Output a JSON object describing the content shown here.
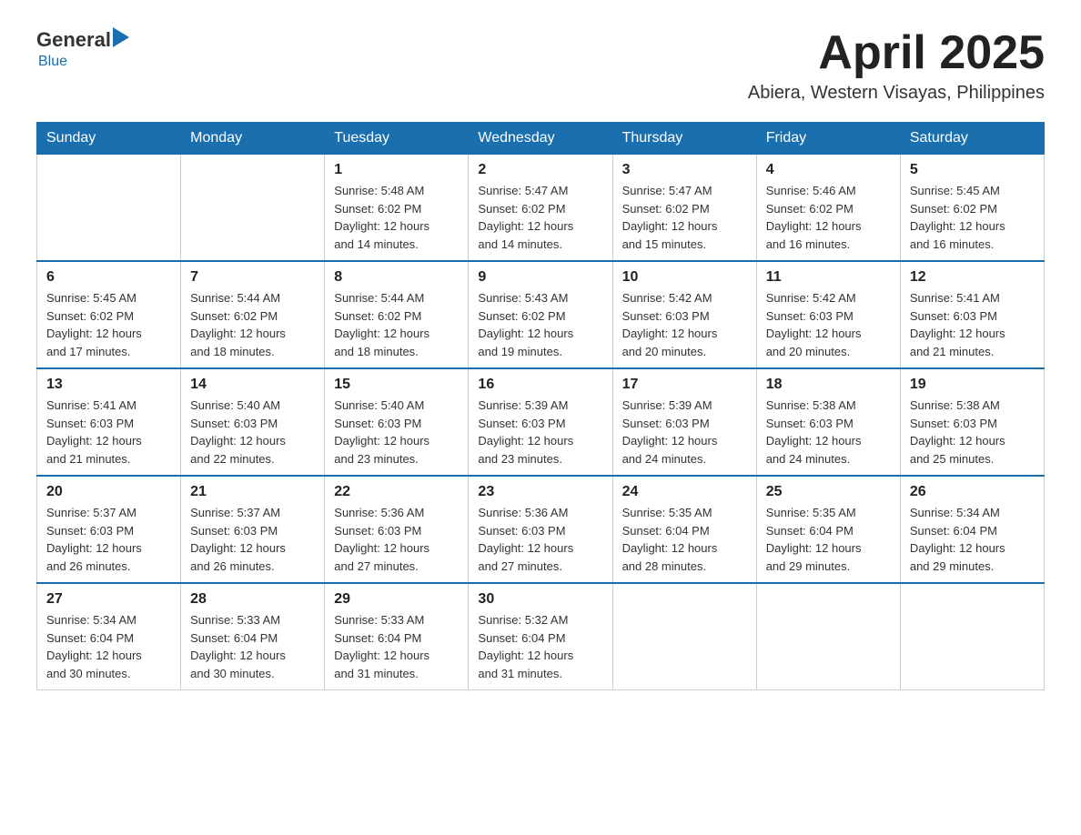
{
  "header": {
    "logo_text": "General",
    "logo_blue": "Blue",
    "month": "April 2025",
    "location": "Abiera, Western Visayas, Philippines"
  },
  "weekdays": [
    "Sunday",
    "Monday",
    "Tuesday",
    "Wednesday",
    "Thursday",
    "Friday",
    "Saturday"
  ],
  "weeks": [
    [
      {
        "day": "",
        "info": ""
      },
      {
        "day": "",
        "info": ""
      },
      {
        "day": "1",
        "info": "Sunrise: 5:48 AM\nSunset: 6:02 PM\nDaylight: 12 hours\nand 14 minutes."
      },
      {
        "day": "2",
        "info": "Sunrise: 5:47 AM\nSunset: 6:02 PM\nDaylight: 12 hours\nand 14 minutes."
      },
      {
        "day": "3",
        "info": "Sunrise: 5:47 AM\nSunset: 6:02 PM\nDaylight: 12 hours\nand 15 minutes."
      },
      {
        "day": "4",
        "info": "Sunrise: 5:46 AM\nSunset: 6:02 PM\nDaylight: 12 hours\nand 16 minutes."
      },
      {
        "day": "5",
        "info": "Sunrise: 5:45 AM\nSunset: 6:02 PM\nDaylight: 12 hours\nand 16 minutes."
      }
    ],
    [
      {
        "day": "6",
        "info": "Sunrise: 5:45 AM\nSunset: 6:02 PM\nDaylight: 12 hours\nand 17 minutes."
      },
      {
        "day": "7",
        "info": "Sunrise: 5:44 AM\nSunset: 6:02 PM\nDaylight: 12 hours\nand 18 minutes."
      },
      {
        "day": "8",
        "info": "Sunrise: 5:44 AM\nSunset: 6:02 PM\nDaylight: 12 hours\nand 18 minutes."
      },
      {
        "day": "9",
        "info": "Sunrise: 5:43 AM\nSunset: 6:02 PM\nDaylight: 12 hours\nand 19 minutes."
      },
      {
        "day": "10",
        "info": "Sunrise: 5:42 AM\nSunset: 6:03 PM\nDaylight: 12 hours\nand 20 minutes."
      },
      {
        "day": "11",
        "info": "Sunrise: 5:42 AM\nSunset: 6:03 PM\nDaylight: 12 hours\nand 20 minutes."
      },
      {
        "day": "12",
        "info": "Sunrise: 5:41 AM\nSunset: 6:03 PM\nDaylight: 12 hours\nand 21 minutes."
      }
    ],
    [
      {
        "day": "13",
        "info": "Sunrise: 5:41 AM\nSunset: 6:03 PM\nDaylight: 12 hours\nand 21 minutes."
      },
      {
        "day": "14",
        "info": "Sunrise: 5:40 AM\nSunset: 6:03 PM\nDaylight: 12 hours\nand 22 minutes."
      },
      {
        "day": "15",
        "info": "Sunrise: 5:40 AM\nSunset: 6:03 PM\nDaylight: 12 hours\nand 23 minutes."
      },
      {
        "day": "16",
        "info": "Sunrise: 5:39 AM\nSunset: 6:03 PM\nDaylight: 12 hours\nand 23 minutes."
      },
      {
        "day": "17",
        "info": "Sunrise: 5:39 AM\nSunset: 6:03 PM\nDaylight: 12 hours\nand 24 minutes."
      },
      {
        "day": "18",
        "info": "Sunrise: 5:38 AM\nSunset: 6:03 PM\nDaylight: 12 hours\nand 24 minutes."
      },
      {
        "day": "19",
        "info": "Sunrise: 5:38 AM\nSunset: 6:03 PM\nDaylight: 12 hours\nand 25 minutes."
      }
    ],
    [
      {
        "day": "20",
        "info": "Sunrise: 5:37 AM\nSunset: 6:03 PM\nDaylight: 12 hours\nand 26 minutes."
      },
      {
        "day": "21",
        "info": "Sunrise: 5:37 AM\nSunset: 6:03 PM\nDaylight: 12 hours\nand 26 minutes."
      },
      {
        "day": "22",
        "info": "Sunrise: 5:36 AM\nSunset: 6:03 PM\nDaylight: 12 hours\nand 27 minutes."
      },
      {
        "day": "23",
        "info": "Sunrise: 5:36 AM\nSunset: 6:03 PM\nDaylight: 12 hours\nand 27 minutes."
      },
      {
        "day": "24",
        "info": "Sunrise: 5:35 AM\nSunset: 6:04 PM\nDaylight: 12 hours\nand 28 minutes."
      },
      {
        "day": "25",
        "info": "Sunrise: 5:35 AM\nSunset: 6:04 PM\nDaylight: 12 hours\nand 29 minutes."
      },
      {
        "day": "26",
        "info": "Sunrise: 5:34 AM\nSunset: 6:04 PM\nDaylight: 12 hours\nand 29 minutes."
      }
    ],
    [
      {
        "day": "27",
        "info": "Sunrise: 5:34 AM\nSunset: 6:04 PM\nDaylight: 12 hours\nand 30 minutes."
      },
      {
        "day": "28",
        "info": "Sunrise: 5:33 AM\nSunset: 6:04 PM\nDaylight: 12 hours\nand 30 minutes."
      },
      {
        "day": "29",
        "info": "Sunrise: 5:33 AM\nSunset: 6:04 PM\nDaylight: 12 hours\nand 31 minutes."
      },
      {
        "day": "30",
        "info": "Sunrise: 5:32 AM\nSunset: 6:04 PM\nDaylight: 12 hours\nand 31 minutes."
      },
      {
        "day": "",
        "info": ""
      },
      {
        "day": "",
        "info": ""
      },
      {
        "day": "",
        "info": ""
      }
    ]
  ]
}
